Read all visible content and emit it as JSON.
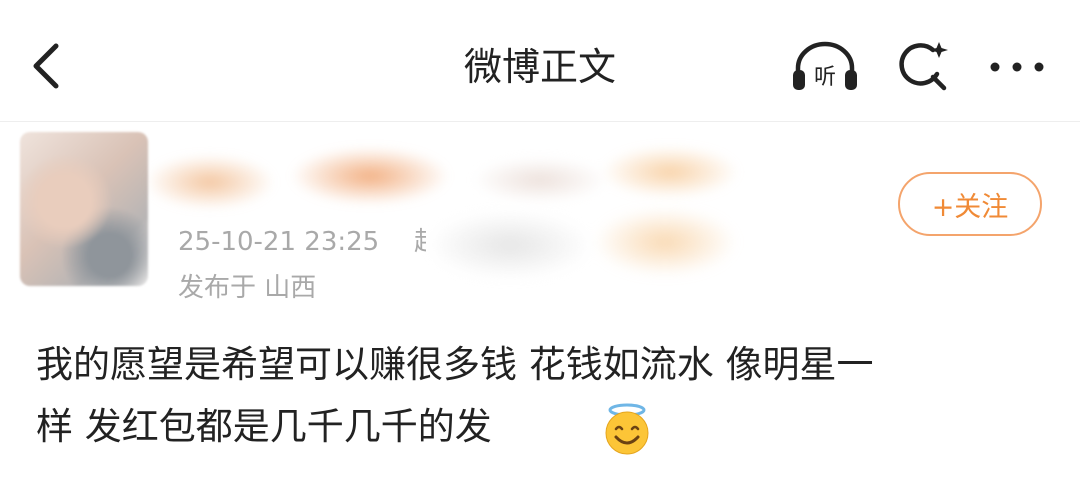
{
  "header": {
    "title": "微博正文",
    "listen_label": "听",
    "back_icon": "chevron-left-icon",
    "search_icon": "search-sparkle-icon",
    "more_icon": "more-dots-icon"
  },
  "author": {
    "timestamp": "25-10-21 23:25",
    "source_truncated": "超",
    "location": "发布于 山西",
    "follow_label": "+关注"
  },
  "post": {
    "line1": "我的愿望是希望可以赚很多钱 花钱如流水 像明星一",
    "line2": "样 发红包都是几千几千的发",
    "emoji": "smiling-face-with-halo-icon"
  },
  "colors": {
    "accent": "#f08a36",
    "follow_border": "#f4a46c",
    "meta_text": "#a9a9a9",
    "body_text": "#222222"
  }
}
